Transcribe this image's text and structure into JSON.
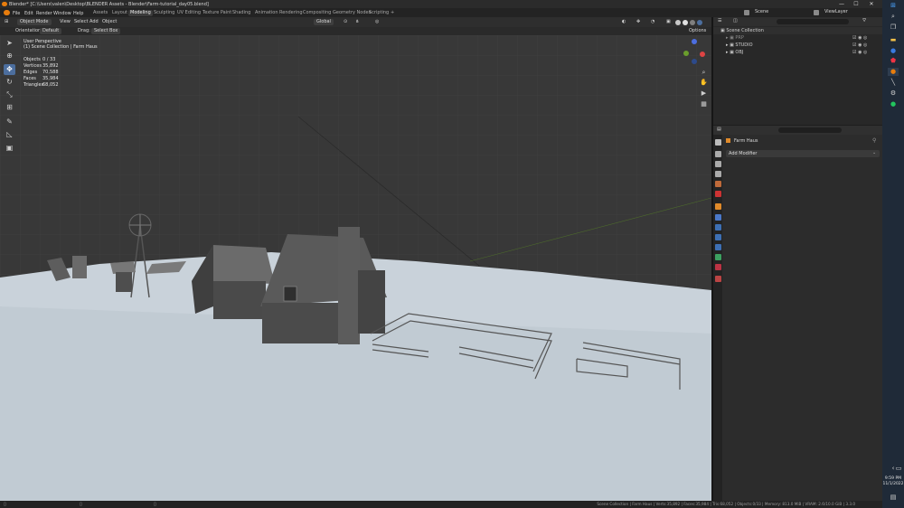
{
  "window": {
    "title": "Blender* [C:\\Users\\valen\\Desktop\\BLENDER Assets - Blender\\Farm-tutorial_day05.blend]",
    "controls": {
      "minimize": "—",
      "maximize": "☐",
      "close": "✕"
    }
  },
  "menu": [
    "File",
    "Edit",
    "Render",
    "Window",
    "Help"
  ],
  "workspaces": [
    {
      "label": "Assets",
      "active": false
    },
    {
      "label": "Layout",
      "active": false
    },
    {
      "label": "Modeling",
      "active": true
    },
    {
      "label": "Sculpting",
      "active": false
    },
    {
      "label": "UV Editing",
      "active": false
    },
    {
      "label": "Texture Paint",
      "active": false
    },
    {
      "label": "Shading",
      "active": false
    },
    {
      "label": "Animation",
      "active": false
    },
    {
      "label": "Rendering",
      "active": false
    },
    {
      "label": "Compositing",
      "active": false
    },
    {
      "label": "Geometry Nodes",
      "active": false
    },
    {
      "label": "Scripting",
      "active": false
    },
    {
      "label": "+",
      "active": false
    }
  ],
  "scene_selector": {
    "label": "Scene"
  },
  "viewlayer_selector": {
    "label": "ViewLayer"
  },
  "header": {
    "mode": "Object Mode",
    "view": "View",
    "select": "Select",
    "add": "Add",
    "object": "Object",
    "transform_orientation": "Global"
  },
  "toolsettings": {
    "orientation_label": "Orientation:",
    "orientation_value": "Default",
    "drag_label": "Drag:",
    "drag_value": "Select Box",
    "options": "Options"
  },
  "viewport_info": {
    "perspective": "User Perspective",
    "collection": "(1) Scene Collection | Farm Haus",
    "stats": [
      {
        "label": "Objects",
        "value": "0 / 33"
      },
      {
        "label": "Vertices",
        "value": "35,892"
      },
      {
        "label": "Edges",
        "value": "70,588"
      },
      {
        "label": "Faces",
        "value": "35,984"
      },
      {
        "label": "Triangles",
        "value": "68,052"
      }
    ]
  },
  "outliner": {
    "rows": [
      {
        "label": "Scene Collection",
        "indent": 0
      },
      {
        "label": "PRP",
        "indent": 1
      },
      {
        "label": "STUDIO",
        "indent": 1
      },
      {
        "label": "OBJ",
        "indent": 1
      }
    ]
  },
  "properties": {
    "object_name": "Farm Haus",
    "add_modifier": "Add Modifier"
  },
  "statusbar": {
    "text": "Scene Collection | Farm Haus | Verts:35,892 | Faces:35,984 | Tris:68,052 | Objects:0/33 | Memory: 813.0 MiB | VRAM: 2.6/10.0 GiB | 3.3.0"
  },
  "clock": {
    "time": "9:59 PM",
    "date": "11/1/2022"
  },
  "colors": {
    "accent": "#4c6e9e",
    "floor": "#c8d1d8",
    "viewport_bg": "#3a3a3a"
  }
}
